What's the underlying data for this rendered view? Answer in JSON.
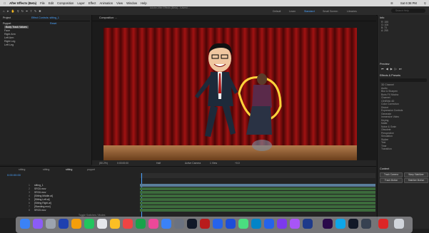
{
  "menubar": {
    "app": "After Effects (Beta)",
    "items": [
      "File",
      "Edit",
      "Composition",
      "Layer",
      "Effect",
      "Animation",
      "View",
      "Window",
      "Help"
    ],
    "clock": "Sat 6:38 PM"
  },
  "header": {
    "title": "Adobe After Effects (Beta) - /Users/...",
    "workspaces": [
      "Default",
      "Learn",
      "Standard",
      "Small Screen",
      "Libraries"
    ],
    "active_workspace": "Standard",
    "search_placeholder": "Search Help"
  },
  "project": {
    "tab": "Project",
    "effect_controls_tab": "Effect Controls: sitting_1",
    "puppet_row": "Puppet",
    "reset_label": "Reset",
    "tree": [
      "Body Track Values",
      "Face",
      "Right Arm",
      "Left Arm",
      "Right Leg",
      "Left Leg"
    ]
  },
  "viewer": {
    "tab": "Composition: ...",
    "zoom": "(50.2%)",
    "timecode": "0:00:00:00",
    "quality": "Half",
    "camera": "Active Camera",
    "views": "1 View",
    "offset": "+0.0"
  },
  "right_panel": {
    "info_title": "Info",
    "info_values": [
      "R: 155",
      "G: 106",
      "B: 73",
      "A: 255"
    ],
    "preview_title": "Preview",
    "effects_title": "Effects & Presets",
    "effects": [
      "3D Channel",
      "Audio",
      "Blur & Sharpen",
      "Boris FX Mocha",
      "Channel",
      "CINEMA 4D",
      "Color Correction",
      "Distort",
      "Expression Controls",
      "Generate",
      "Immersive Video",
      "Keying",
      "Matte",
      "Noise & Grain",
      "Obsolete",
      "Perspective",
      "Simulation",
      "Stylize",
      "Text",
      "Time",
      "Transition"
    ],
    "content_title": "Content",
    "content_buttons": [
      "Track Camera",
      "Warp Stabilizer",
      "Track Motion",
      "Stabilize Motion"
    ]
  },
  "timeline": {
    "tabs": [
      "sitting",
      "sitting",
      "sitting",
      "puppet"
    ],
    "active_tab_index": 2,
    "timecode": "0:00:00:00",
    "layers": [
      {
        "num": "1",
        "name": "sitting_1"
      },
      {
        "num": "2",
        "name": "SRC6.mov"
      },
      {
        "num": "3",
        "name": "SRC6.mov"
      },
      {
        "num": "4",
        "name": "[Sitting Middle.ai]"
      },
      {
        "num": "5",
        "name": "[Sitting Left.ai]"
      },
      {
        "num": "6",
        "name": "[Sitting Right.ai]"
      },
      {
        "num": "7",
        "name": "[Standing.mov]"
      },
      {
        "num": "8",
        "name": "SRC5.mov"
      }
    ],
    "footer": "Toggle Switches / Modes"
  },
  "colors": {
    "accent": "#4aa3ff",
    "curtain": "#8a0d0d",
    "floor": "#8a5a34",
    "track": "#3c6b3c"
  }
}
